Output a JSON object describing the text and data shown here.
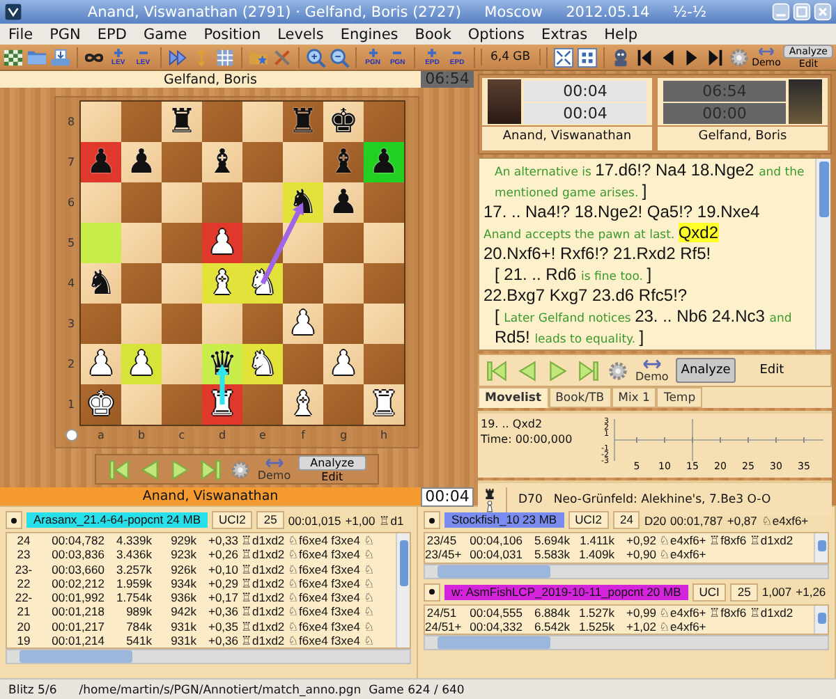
{
  "window": {
    "title": "Anand, Viswanathan (2791) · Gelfand, Boris (2727)     Moscow     2012.05.14     ½-½"
  },
  "menu": [
    "File",
    "PGN",
    "EPD",
    "Game",
    "Position",
    "Levels",
    "Engines",
    "Book",
    "Options",
    "Extras",
    "Help"
  ],
  "toolbar": {
    "sub_labels": [
      "LEV",
      "LEV",
      "PGN",
      "PGN",
      "EPD",
      "EPD"
    ],
    "memory": "6,4 GB",
    "demo": "Demo",
    "analyze": "Analyze",
    "edit": "Edit"
  },
  "board_panel": {
    "top_player": "Gelfand, Boris",
    "top_clock": "06:54",
    "bottom_player": "Anand, Viswanathan",
    "bottom_clock": "00:04",
    "white_to_move": true,
    "files": [
      "a",
      "b",
      "c",
      "d",
      "e",
      "f",
      "g",
      "h"
    ],
    "ranks": [
      "8",
      "7",
      "6",
      "5",
      "4",
      "3",
      "2",
      "1"
    ],
    "rows": [
      [
        {},
        {},
        {
          "piece": "♜",
          "white": false
        },
        {},
        {},
        {
          "piece": "♜",
          "white": false
        },
        {
          "piece": "♚",
          "white": false
        },
        {}
      ],
      [
        {
          "piece": "♟",
          "white": false,
          "color": "#e0392b"
        },
        {
          "piece": "♟",
          "white": false
        },
        {},
        {
          "piece": "♝",
          "white": false
        },
        {},
        {},
        {
          "piece": "♝",
          "white": false
        },
        {
          "piece": "♟",
          "white": false,
          "color": "#22d022"
        }
      ],
      [
        {},
        {},
        {},
        {},
        {},
        {
          "piece": "♞",
          "white": false,
          "color": "#e2e23a"
        },
        {
          "piece": "♟",
          "white": false
        },
        {}
      ],
      [
        {
          "color": "#c8ec4a"
        },
        {},
        {},
        {
          "piece": "♟",
          "white": true,
          "color": "#e0392b"
        },
        {},
        {},
        {},
        {}
      ],
      [
        {
          "piece": "♞",
          "white": false
        },
        {},
        {},
        {
          "piece": "♝",
          "white": true,
          "color": "#e2e23a"
        },
        {
          "piece": "♞",
          "white": true,
          "color": "#e2e23a"
        },
        {},
        {},
        {}
      ],
      [
        {},
        {},
        {},
        {},
        {},
        {
          "piece": "♟",
          "white": true
        },
        {},
        {}
      ],
      [
        {
          "piece": "♟",
          "white": true
        },
        {
          "piece": "♟",
          "white": true,
          "color": "#d6e43a"
        },
        {},
        {
          "piece": "♛",
          "white": false,
          "color": "#c8ec4a"
        },
        {
          "piece": "♞",
          "white": true,
          "color": "#e2e23a"
        },
        {},
        {
          "piece": "♟",
          "white": true
        },
        {}
      ],
      [
        {
          "piece": "♚",
          "white": true
        },
        {},
        {},
        {
          "piece": "♜",
          "white": true,
          "color": "#e0392b"
        },
        {},
        {
          "piece": "♝",
          "white": true
        },
        {},
        {
          "piece": "♜",
          "white": true
        }
      ]
    ],
    "nav": {
      "demo": "Demo",
      "analyze": "Analyze",
      "edit": "Edit"
    }
  },
  "players": [
    {
      "name": "Anand, Viswanathan",
      "clocks": [
        "00:04",
        "00:04"
      ],
      "active": true
    },
    {
      "name": "Gelfand, Boris",
      "clocks": [
        "06:54",
        "00:00"
      ],
      "active": false
    }
  ],
  "notation": [
    {
      "kind": "variation",
      "segments": [
        {
          "kind": "comment",
          "text": "An alternative is "
        },
        {
          "kind": "move",
          "text": "17.d6!? Na4 18.Nge2 "
        },
        {
          "kind": "comment",
          "text": "and the mentioned game arises. "
        },
        {
          "kind": "move",
          "text": "]"
        }
      ]
    },
    {
      "kind": "mainline",
      "segments": [
        {
          "kind": "move",
          "text": "17. .. Na4!? 18.Nge2! Qa5!? 19.Nxe4"
        }
      ]
    },
    {
      "kind": "mainline",
      "segments": [
        {
          "kind": "comment",
          "text": "Anand accepts the pawn at last. "
        },
        {
          "kind": "highlight",
          "text": "Qxd2"
        }
      ]
    },
    {
      "kind": "mainline",
      "segments": [
        {
          "kind": "move",
          "text": "20.Nxf6+! Rxf6!? 21.Rxd2 Rf5!"
        }
      ]
    },
    {
      "kind": "variation",
      "segments": [
        {
          "kind": "move",
          "text": "[ 21. .. Rd6 "
        },
        {
          "kind": "comment",
          "text": "is fine too. "
        },
        {
          "kind": "move",
          "text": "]"
        }
      ]
    },
    {
      "kind": "mainline",
      "segments": [
        {
          "kind": "move",
          "text": "22.Bxg7 Kxg7 23.d6 Rfc5!?"
        }
      ]
    },
    {
      "kind": "variation",
      "segments": [
        {
          "kind": "move",
          "text": "[ "
        },
        {
          "kind": "comment",
          "text": "Later Gelfand notices "
        },
        {
          "kind": "move",
          "text": "23. .. Nb6 24.Nc3 "
        },
        {
          "kind": "comment",
          "text": "and "
        },
        {
          "kind": "move",
          "text": "Rd5! "
        },
        {
          "kind": "comment",
          "text": "leads to equality. "
        },
        {
          "kind": "move",
          "text": "]"
        }
      ]
    }
  ],
  "notation_nav": {
    "demo": "Demo",
    "analyze": "Analyze",
    "edit": "Edit"
  },
  "tabs": [
    {
      "label": "Movelist",
      "selected": true
    },
    {
      "label": "Book/TB",
      "selected": false
    },
    {
      "label": "Mix 1",
      "selected": false
    },
    {
      "label": "Temp",
      "selected": false
    }
  ],
  "eval": {
    "move": "19. .. Qxd2",
    "time": "Time: 00:00,000",
    "yticks": [
      "3",
      "2",
      "1",
      "-1",
      "-2",
      "-3"
    ],
    "xticks": [
      "5",
      "10",
      "15",
      "20",
      "25",
      "30",
      "35"
    ]
  },
  "opening": {
    "eco": "D70",
    "name": "Neo-Grünfeld: Alekhine's, 7.Be3 O-O"
  },
  "engine_panes": [
    {
      "engines": [
        {
          "name": "Arasanx_21.4-64-popcnt  24 MB",
          "color": "#28e0ea",
          "protocol": "UCI2",
          "depth": "25",
          "info": [
            "00:01,015",
            "+1,00",
            "♖d1"
          ],
          "rows": [
            [
              "24",
              "00:04,782",
              "4.339k",
              "929k",
              "+0,33",
              "♖d1xd2 ♘f6xe4 f3xe4 ♘"
            ],
            [
              "23",
              "00:03,836",
              "3.436k",
              "923k",
              "+0,26",
              "♖d1xd2 ♘f6xe4 f3xe4 ♘"
            ],
            [
              "23-",
              "00:03,660",
              "3.257k",
              "926k",
              "+0,10",
              "♖d1xd2 ♘f6xe4 f3xe4 ♘"
            ],
            [
              "22",
              "00:02,212",
              "1.959k",
              "934k",
              "+0,29",
              "♖d1xd2 ♘f6xe4 f3xe4 ♘"
            ],
            [
              "22-",
              "00:01,992",
              "1.754k",
              "936k",
              "+0,17",
              "♖d1xd2 ♘f6xe4 f3xe4 ♘"
            ],
            [
              "21",
              "00:01,218",
              "989k",
              "942k",
              "+0,36",
              "♖d1xd2 ♘f6xe4 f3xe4 ♘"
            ],
            [
              "20",
              "00:01,217",
              "784k",
              "931k",
              "+0,35",
              "♖d1xd2 ♘f6xe4 f3xe4 ♘"
            ],
            [
              "19",
              "00:01,214",
              "541k",
              "931k",
              "+0,36",
              "♖d1xd2 ♘f6xe4 f3xe4 ♘"
            ]
          ]
        }
      ]
    },
    {
      "engines": [
        {
          "name": "Stockfish_10  23 MB",
          "color": "#7a8cf0",
          "protocol": "UCI2",
          "depth": "24",
          "info": [
            "D20",
            "00:01,787",
            "+0,87",
            "♘e4xf6+"
          ],
          "rows": [
            [
              "23/45",
              "00:04,106",
              "5.694k",
              "1.411k",
              "+0,92",
              "♘e4xf6+ ♖f8xf6 ♖d1xd2"
            ],
            [
              "23/45+",
              "00:04,031",
              "5.583k",
              "1.409k",
              "+0,90",
              "♘e4xf6+"
            ]
          ]
        },
        {
          "name": "w: AsmFishLCP_2019-10-11_popcnt  20 MB",
          "color": "#d424dc",
          "protocol": "UCI",
          "depth": "25",
          "info": [
            "1,007",
            "+1,26"
          ],
          "rows": [
            [
              "24/51",
              "00:04,555",
              "6.884k",
              "1.527k",
              "+0,99",
              "♘e4xf6+ ♖f8xf6 ♖d1xd2"
            ],
            [
              "24/51+",
              "00:04,332",
              "6.542k",
              "1.525k",
              "+1,02",
              "♘e4xf6+"
            ]
          ]
        }
      ]
    }
  ],
  "status_bar": [
    "Blitz 5/6",
    "/home/martin/s/PGN/Annotiert/match_anno.pgn  Game 624 / 640"
  ]
}
